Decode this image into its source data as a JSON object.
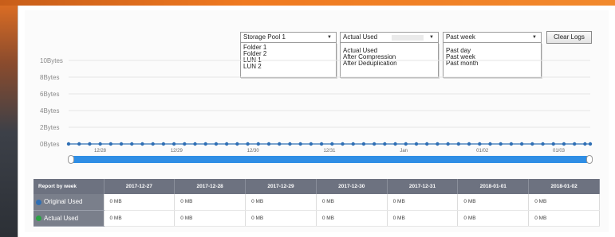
{
  "filters": {
    "storage": {
      "selected": "Storage Pool 1",
      "options": [
        "Folder 1",
        "Folder 2",
        "LUN 1",
        "LUN 2"
      ]
    },
    "metric": {
      "selected": "Actual Used",
      "options": [
        "Actual Used",
        "After Compression",
        "After Deduplication"
      ]
    },
    "period": {
      "selected": "Past week",
      "options": [
        "Past day",
        "Past week",
        "Past month"
      ]
    },
    "clear_logs_label": "Clear Logs"
  },
  "chart_data": {
    "type": "line",
    "y_ticks": [
      "10Bytes",
      "8Bytes",
      "6Bytes",
      "4Bytes",
      "2Bytes",
      "0Bytes"
    ],
    "x_tick_labels": [
      "12/28",
      "12/29",
      "12/30",
      "12/31",
      "Jan",
      "01/02",
      "01/03"
    ],
    "series": [
      {
        "color": "#2f6fb5",
        "values": [
          0,
          0,
          0,
          0,
          0,
          0,
          0,
          0,
          0,
          0,
          0,
          0,
          0,
          0,
          0,
          0,
          0,
          0,
          0,
          0,
          0,
          0,
          0,
          0,
          0,
          0,
          0,
          0,
          0,
          0,
          0,
          0,
          0,
          0,
          0,
          0,
          0,
          0,
          0,
          0,
          0,
          0,
          0,
          0,
          0,
          0,
          0,
          0,
          0,
          0,
          0,
          0,
          0,
          0,
          0,
          0,
          0,
          0,
          0,
          0,
          0,
          0,
          0,
          0,
          0,
          0,
          0,
          0,
          0,
          0,
          0,
          0,
          0,
          0,
          0,
          0,
          0,
          0,
          0,
          0,
          0,
          0,
          0,
          0,
          0,
          0,
          0,
          0,
          0,
          0,
          0,
          0,
          0,
          0,
          0,
          0,
          0,
          0,
          0,
          0
        ]
      }
    ],
    "ylim": [
      0,
      10
    ]
  },
  "table": {
    "corner_label": "Report by week",
    "dates": [
      "2017-12-27",
      "2017-12-28",
      "2017-12-29",
      "2017-12-30",
      "2017-12-31",
      "2018-01-01",
      "2018-01-02"
    ],
    "rows": [
      {
        "label": "Original Used",
        "color": "#2f6fb5",
        "values": [
          "0 MB",
          "0 MB",
          "0 MB",
          "0 MB",
          "0 MB",
          "0 MB",
          "0 MB"
        ]
      },
      {
        "label": "Actual Used",
        "color": "#2aa344",
        "values": [
          "0 MB",
          "0 MB",
          "0 MB",
          "0 MB",
          "0 MB",
          "0 MB",
          "0 MB"
        ]
      }
    ]
  }
}
